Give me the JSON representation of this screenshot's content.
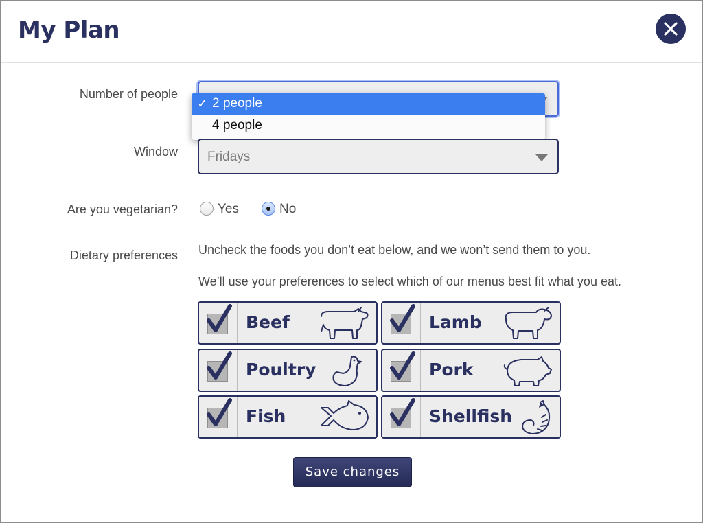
{
  "modal": {
    "title": "My Plan"
  },
  "form": {
    "people": {
      "label": "Number of people",
      "options": [
        "2 people",
        "4 people"
      ],
      "selected_mark": "✓"
    },
    "window": {
      "label": "Window",
      "value": "Fridays"
    },
    "vegetarian": {
      "label": "Are you vegetarian?",
      "options": [
        {
          "label": "Yes",
          "checked": false
        },
        {
          "label": "No",
          "checked": true
        }
      ]
    },
    "dietary": {
      "label": "Dietary preferences",
      "info_line_1": "Uncheck the foods you don’t eat below, and we won’t send them to you.",
      "info_line_2": "We’ll use your preferences to select which of our menus best fit what you eat.",
      "foods": [
        {
          "name": "Beef",
          "checked": true,
          "icon": "cow-icon"
        },
        {
          "name": "Lamb",
          "checked": true,
          "icon": "sheep-icon"
        },
        {
          "name": "Poultry",
          "checked": true,
          "icon": "chicken-icon"
        },
        {
          "name": "Pork",
          "checked": true,
          "icon": "pig-icon"
        },
        {
          "name": "Fish",
          "checked": true,
          "icon": "fish-icon"
        },
        {
          "name": "Shellfish",
          "checked": true,
          "icon": "shrimp-icon"
        }
      ]
    },
    "save_label": "Save changes"
  },
  "colors": {
    "brand_navy": "#2a3060",
    "select_highlight": "#3b7ef0"
  }
}
